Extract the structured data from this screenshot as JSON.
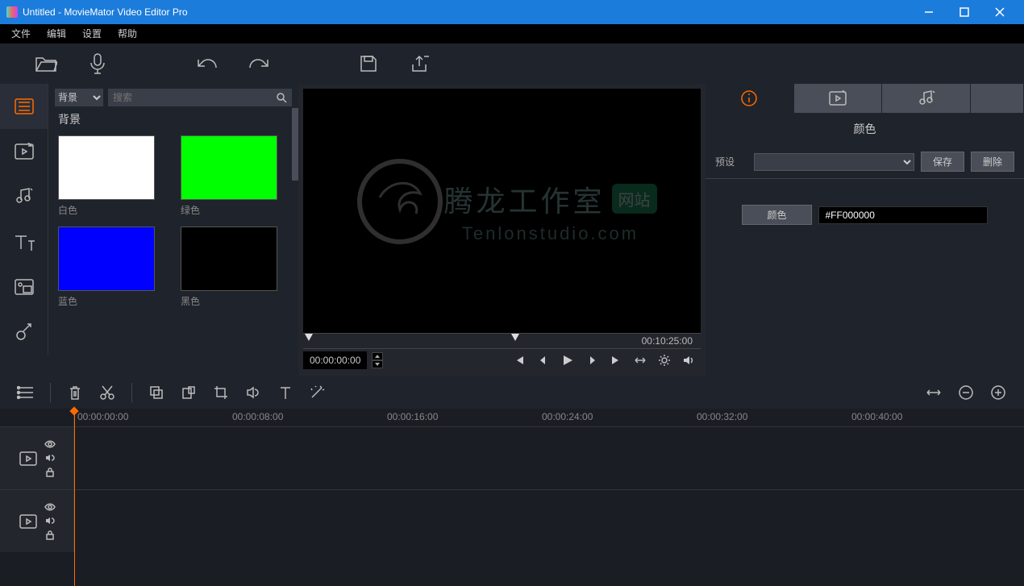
{
  "window": {
    "title": "Untitled - MovieMator Video Editor Pro"
  },
  "menu": [
    "文件",
    "编辑",
    "设置",
    "帮助"
  ],
  "assets": {
    "filter_label": "背景",
    "search_placeholder": "搜索",
    "heading": "背景",
    "items": [
      {
        "label": "白色",
        "color": "#ffffff"
      },
      {
        "label": "绿色",
        "color": "#00ff00"
      },
      {
        "label": "蓝色",
        "color": "#0000ff"
      },
      {
        "label": "黑色",
        "color": "#000000"
      }
    ]
  },
  "preview": {
    "trim_end_time": "00:10:25:00",
    "current_time": "00:00:00:00"
  },
  "watermark": {
    "zh": "腾龙工作室",
    "badge": "网站",
    "en": "Tenlonstudio.com"
  },
  "inspector": {
    "title": "颜色",
    "preset_label": "预设",
    "save_label": "保存",
    "delete_label": "删除",
    "color_label": "颜色",
    "color_value": "#FF000000"
  },
  "timeline": {
    "ticks": [
      "00:00:00:00",
      "00:00:08:00",
      "00:00:16:00",
      "00:00:24:00",
      "00:00:32:00",
      "00:00:40:00"
    ]
  }
}
